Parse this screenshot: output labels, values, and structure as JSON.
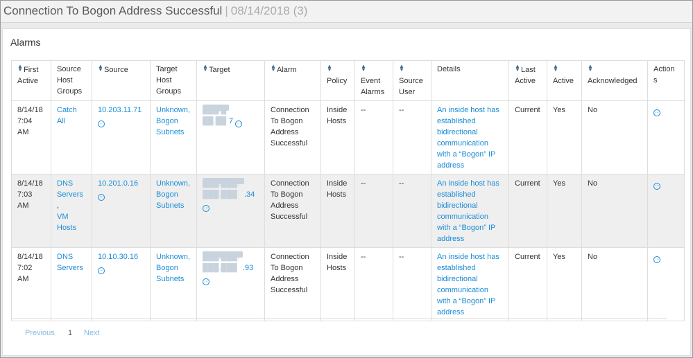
{
  "header": {
    "title": "Connection To Bogon Address Successful",
    "separator": "|",
    "subtitle": "08/14/2018 (3)"
  },
  "panel": {
    "title": "Alarms"
  },
  "columns": {
    "first_active": "First Active",
    "source_host_groups": "Source Host Groups",
    "source": "Source",
    "target_host_groups": "Target Host Groups",
    "target": "Target",
    "alarm": "Alarm",
    "policy": "Policy",
    "event_alarms": "Event Alarms",
    "source_user": "Source User",
    "details": "Details",
    "last_active": "Last Active",
    "active": "Active",
    "acknowledged": "Acknowledged",
    "actions": "Actions"
  },
  "rows": [
    {
      "first_active": "8/14/18 7:04 AM",
      "source_host_groups": "Catch All",
      "source": "10.203.11.71",
      "target_host_groups": "Unknown, Bogon Subnets",
      "target_masked": "███.███.██",
      "target_suffix": "7",
      "alarm": "Connection To Bogon Address Successful",
      "policy": "Inside Hosts",
      "event_alarms": "--",
      "source_user": "--",
      "details": "An inside host has established bidirectional communication with a “Bogon” IP address",
      "last_active": "Current",
      "active": "Yes",
      "acknowledged": "No"
    },
    {
      "first_active": "8/14/18 7:03 AM",
      "source_host_groups_1": "DNS Servers",
      "source_host_groups_sep": ",",
      "source_host_groups_2": "VM Hosts",
      "source": "10.201.0.16",
      "target_host_groups": "Unknown, Bogon Subnets",
      "target_masked": "███.███.███.███",
      "target_suffix": ".34",
      "alarm": "Connection To Bogon Address Successful",
      "policy": "Inside Hosts",
      "event_alarms": "--",
      "source_user": "--",
      "details": "An inside host has established bidirectional communication with a “Bogon” IP address",
      "last_active": "Current",
      "active": "Yes",
      "acknowledged": "No"
    },
    {
      "first_active": "8/14/18 7:02 AM",
      "source_host_groups": "DNS Servers",
      "source": "10.10.30.16",
      "target_host_groups": "Unknown, Bogon Subnets",
      "target_masked": "███.███.███.███",
      "target_suffix": ".93",
      "alarm": "Connection To Bogon Address Successful",
      "policy": "Inside Hosts",
      "event_alarms": "--",
      "source_user": "--",
      "details": "An inside host has established bidirectional communication with a “Bogon” IP address",
      "last_active": "Current",
      "active": "Yes",
      "acknowledged": "No"
    }
  ],
  "pagination": {
    "previous": "Previous",
    "page": "1",
    "next": "Next"
  },
  "icons": {
    "more": "ellipsis-circle-icon",
    "sort": "sort-arrows-icon"
  },
  "colors": {
    "link": "#1a8cd8",
    "row_shaded": "#efefef",
    "pager_link": "#7fbbe6"
  }
}
